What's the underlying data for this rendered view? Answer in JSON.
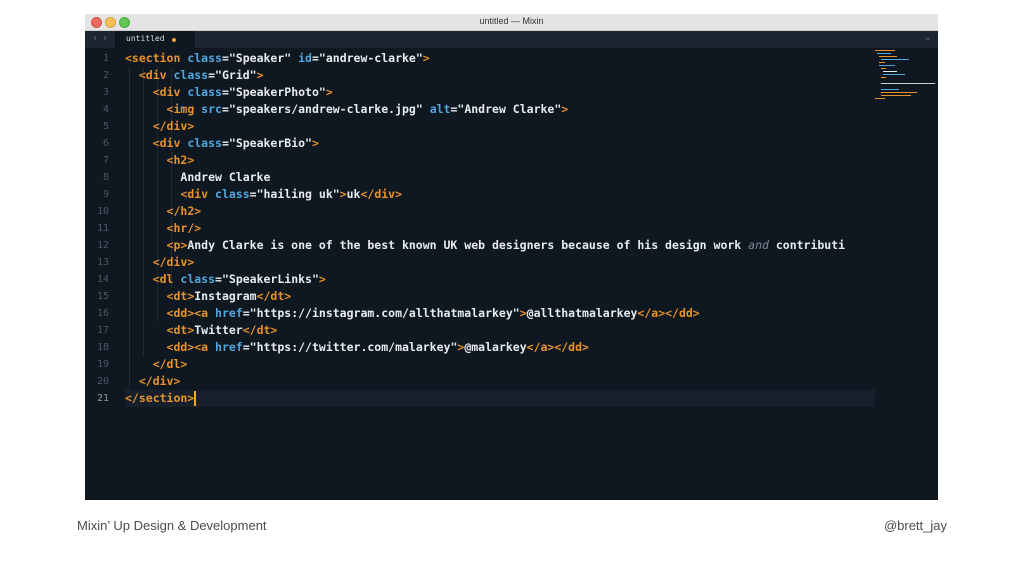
{
  "window": {
    "title": "untitled — Mixin"
  },
  "tab": {
    "label": "untitled"
  },
  "editor": {
    "line_numbers": [
      "1",
      "2",
      "3",
      "4",
      "5",
      "6",
      "7",
      "8",
      "9",
      "10",
      "11",
      "12",
      "13",
      "14",
      "15",
      "16",
      "17",
      "18",
      "19",
      "20",
      "21"
    ],
    "lines": [
      [
        {
          "t": "tag",
          "v": "<section "
        },
        {
          "t": "attr",
          "v": "class"
        },
        {
          "t": "punct",
          "v": "="
        },
        {
          "t": "str",
          "v": "\"Speaker\" "
        },
        {
          "t": "attr",
          "v": "id"
        },
        {
          "t": "punct",
          "v": "="
        },
        {
          "t": "str",
          "v": "\"andrew-clarke\""
        },
        {
          "t": "tag",
          "v": ">"
        }
      ],
      [
        {
          "t": "punct",
          "v": "  "
        },
        {
          "t": "tag",
          "v": "<div "
        },
        {
          "t": "attr",
          "v": "class"
        },
        {
          "t": "punct",
          "v": "="
        },
        {
          "t": "str",
          "v": "\"Grid\""
        },
        {
          "t": "tag",
          "v": ">"
        }
      ],
      [
        {
          "t": "punct",
          "v": "    "
        },
        {
          "t": "tag",
          "v": "<div "
        },
        {
          "t": "attr",
          "v": "class"
        },
        {
          "t": "punct",
          "v": "="
        },
        {
          "t": "str",
          "v": "\"SpeakerPhoto\""
        },
        {
          "t": "tag",
          "v": ">"
        }
      ],
      [
        {
          "t": "punct",
          "v": "      "
        },
        {
          "t": "tag",
          "v": "<img "
        },
        {
          "t": "attr",
          "v": "src"
        },
        {
          "t": "punct",
          "v": "="
        },
        {
          "t": "str",
          "v": "\"speakers/andrew-clarke.jpg\" "
        },
        {
          "t": "attr",
          "v": "alt"
        },
        {
          "t": "punct",
          "v": "="
        },
        {
          "t": "str",
          "v": "\"Andrew Clarke\""
        },
        {
          "t": "tag",
          "v": ">"
        }
      ],
      [
        {
          "t": "punct",
          "v": "    "
        },
        {
          "t": "tag",
          "v": "</div>"
        }
      ],
      [
        {
          "t": "punct",
          "v": "    "
        },
        {
          "t": "tag",
          "v": "<div "
        },
        {
          "t": "attr",
          "v": "class"
        },
        {
          "t": "punct",
          "v": "="
        },
        {
          "t": "str",
          "v": "\"SpeakerBio\""
        },
        {
          "t": "tag",
          "v": ">"
        }
      ],
      [
        {
          "t": "punct",
          "v": "      "
        },
        {
          "t": "tag",
          "v": "<h2>"
        }
      ],
      [
        {
          "t": "punct",
          "v": "        "
        },
        {
          "t": "str",
          "v": "Andrew Clarke"
        }
      ],
      [
        {
          "t": "punct",
          "v": "        "
        },
        {
          "t": "tag",
          "v": "<div "
        },
        {
          "t": "attr",
          "v": "class"
        },
        {
          "t": "punct",
          "v": "="
        },
        {
          "t": "str",
          "v": "\"hailing uk\""
        },
        {
          "t": "tag",
          "v": ">"
        },
        {
          "t": "str",
          "v": "uk"
        },
        {
          "t": "tag",
          "v": "</div>"
        }
      ],
      [
        {
          "t": "punct",
          "v": "      "
        },
        {
          "t": "tag",
          "v": "</h2>"
        }
      ],
      [
        {
          "t": "punct",
          "v": "      "
        },
        {
          "t": "tag",
          "v": "<hr/>"
        }
      ],
      [
        {
          "t": "punct",
          "v": "      "
        },
        {
          "t": "tag",
          "v": "<p>"
        },
        {
          "t": "str",
          "v": "Andy Clarke is one of the best known UK web designers because of his design work "
        },
        {
          "t": "em",
          "v": "and"
        },
        {
          "t": "str",
          "v": " contributi"
        }
      ],
      [
        {
          "t": "punct",
          "v": "    "
        },
        {
          "t": "tag",
          "v": "</div>"
        }
      ],
      [
        {
          "t": "punct",
          "v": "    "
        },
        {
          "t": "tag",
          "v": "<dl "
        },
        {
          "t": "attr",
          "v": "class"
        },
        {
          "t": "punct",
          "v": "="
        },
        {
          "t": "str",
          "v": "\"SpeakerLinks\""
        },
        {
          "t": "tag",
          "v": ">"
        }
      ],
      [
        {
          "t": "punct",
          "v": "      "
        },
        {
          "t": "tag",
          "v": "<dt>"
        },
        {
          "t": "str",
          "v": "Instagram"
        },
        {
          "t": "tag",
          "v": "</dt>"
        }
      ],
      [
        {
          "t": "punct",
          "v": "      "
        },
        {
          "t": "tag",
          "v": "<dd>"
        },
        {
          "t": "tag",
          "v": "<a "
        },
        {
          "t": "attr",
          "v": "href"
        },
        {
          "t": "punct",
          "v": "="
        },
        {
          "t": "str",
          "v": "\"https://instagram.com/allthatmalarkey\""
        },
        {
          "t": "tag",
          "v": ">"
        },
        {
          "t": "str",
          "v": "@allthatmalarkey"
        },
        {
          "t": "tag",
          "v": "</a></dd>"
        }
      ],
      [
        {
          "t": "punct",
          "v": "      "
        },
        {
          "t": "tag",
          "v": "<dt>"
        },
        {
          "t": "str",
          "v": "Twitter"
        },
        {
          "t": "tag",
          "v": "</dt>"
        }
      ],
      [
        {
          "t": "punct",
          "v": "      "
        },
        {
          "t": "tag",
          "v": "<dd>"
        },
        {
          "t": "tag",
          "v": "<a "
        },
        {
          "t": "attr",
          "v": "href"
        },
        {
          "t": "punct",
          "v": "="
        },
        {
          "t": "str",
          "v": "\"https://twitter.com/malarkey\""
        },
        {
          "t": "tag",
          "v": ">"
        },
        {
          "t": "str",
          "v": "@malarkey"
        },
        {
          "t": "tag",
          "v": "</a></dd>"
        }
      ],
      [
        {
          "t": "punct",
          "v": "    "
        },
        {
          "t": "tag",
          "v": "</dl>"
        }
      ],
      [
        {
          "t": "punct",
          "v": "  "
        },
        {
          "t": "tag",
          "v": "</div>"
        }
      ],
      [
        {
          "t": "tag",
          "v": "</section>"
        }
      ]
    ]
  },
  "footer": {
    "left": "Mixin’ Up Design & Development",
    "right": "@brett_jay"
  },
  "colors": {
    "editor_bg": "#0f1820",
    "tag": "#e9922b",
    "attribute": "#4fa7df",
    "text": "#e8ecef",
    "cursor": "#f5a623"
  },
  "icons": [
    "close-icon",
    "minimize-icon",
    "zoom-icon",
    "back-arrow-icon",
    "forward-arrow-icon",
    "chevron-down-icon"
  ]
}
